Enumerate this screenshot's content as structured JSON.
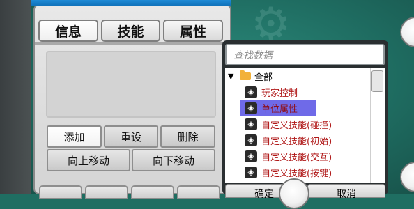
{
  "tabs": [
    {
      "label": "信息",
      "active": true
    },
    {
      "label": "技能",
      "active": false
    },
    {
      "label": "属性",
      "active": false
    }
  ],
  "buttons": {
    "add": "添加",
    "reset": "重设",
    "delete": "删除",
    "move_up": "向上移动",
    "move_down": "向下移动"
  },
  "search": {
    "placeholder": "查找数据"
  },
  "tree": {
    "root": {
      "label": "全部",
      "expanded": true,
      "icon": "folder-icon"
    },
    "items": [
      {
        "label": "玩家控制",
        "icon": "unity-icon"
      },
      {
        "label": "单位属性",
        "icon": "unity-icon",
        "selected": true
      },
      {
        "label": "自定义技能(碰撞)",
        "icon": "unity-icon"
      },
      {
        "label": "自定义技能(初始)",
        "icon": "unity-icon"
      },
      {
        "label": "自定义技能(交互)",
        "icon": "unity-icon"
      },
      {
        "label": "自定义技能(按键)",
        "icon": "unity-icon"
      }
    ]
  },
  "footer": {
    "confirm": "确定",
    "cancel": "取消"
  },
  "colors": {
    "selection": "#6f6ae8",
    "item_text": "#b01818",
    "background": "#1f6e62",
    "top_bar": "#1f8ad6"
  }
}
